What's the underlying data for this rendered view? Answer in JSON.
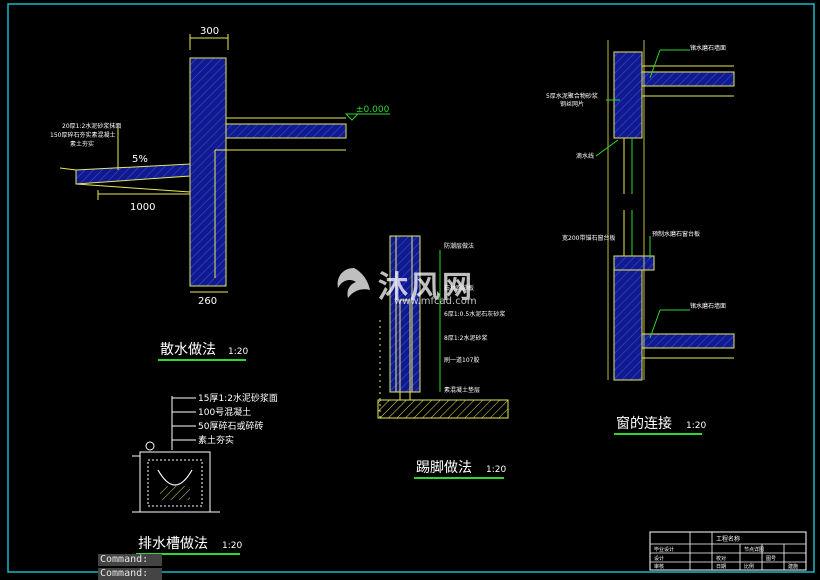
{
  "drawing": {
    "dimensions": {
      "dim_300": "300",
      "dim_260": "260",
      "dim_1000": "1000",
      "slope": "5%",
      "elevation": "±0.000"
    },
    "apron_notes": [
      "20厚1:2水泥砂浆抹面",
      "150厚碎石夯实素混凝土",
      "素土夯实"
    ],
    "plinth_notes": [
      "防潮层做法",
      "石材踢脚板",
      "6厚1:0.5水泥石灰砂浆",
      "8厚1:2水泥砂浆",
      "刷一道107胶",
      "素混凝土垫层"
    ],
    "window_notes": {
      "top_right": "锗水磨石墙面",
      "left_1": "5厚水泥聚合物砂浆",
      "left_2": "钢丝网片",
      "drip": "滴水线",
      "sill_left": "宽200带锚石窗台板",
      "sill_right": "预制水磨石窗台板",
      "bottom_right": "锗水磨石墙面"
    },
    "drain_notes": [
      "15厚1:2水泥砂浆面",
      "100号混凝土",
      "50厚碎石或碎砖",
      "素土夯实"
    ],
    "titles": {
      "apron": "散水做法",
      "apron_scale": "1:20",
      "plinth": "踢脚做法",
      "plinth_scale": "1:20",
      "window": "窗的连接",
      "window_scale": "1:20",
      "drain": "排水槽做法",
      "drain_scale": "1:20"
    },
    "title_block": {
      "project": "工程名称",
      "drawing_name": "节点详图",
      "row1": "设计",
      "row2": "校对",
      "row3": "审核",
      "cell_a": "毕业设计",
      "cell_b": "图号",
      "cell_c": "日期",
      "cell_d": "比例",
      "cell_e": "建施"
    },
    "watermark": {
      "name": "沐风网",
      "url": "www.mfcad.com"
    }
  },
  "command_line": {
    "line1": "Command:",
    "line2": "Command:"
  },
  "colors": {
    "background": "#000000",
    "frame": "#17b7c9",
    "wall_blue": "#1a2cc8",
    "hatch": "#3448ff",
    "line_yellow": "#e8e85a",
    "text": "#ffffff",
    "dim_cyan": "#39d9e5",
    "scale_green": "#2ed92e"
  }
}
